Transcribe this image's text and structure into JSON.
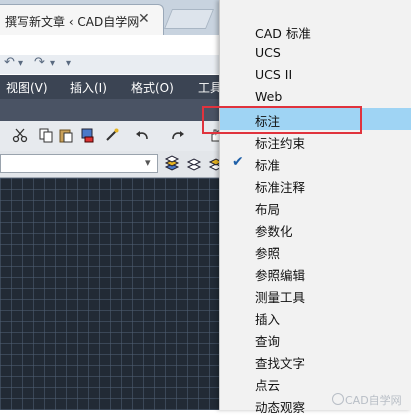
{
  "browser": {
    "tab_title": "撰写新文章 ‹ CAD自学网",
    "tab_close": "✕"
  },
  "quick_access": {
    "undo": "↶",
    "redo": "↷",
    "more": "▾"
  },
  "menubar": {
    "items": [
      "视图(V)",
      "插入(I)",
      "格式(O)",
      "工具"
    ]
  },
  "toolbar": {
    "icons": [
      "cut-icon",
      "copy-icon",
      "paste-icon",
      "match-properties-icon",
      "brush-icon",
      "undo-icon",
      "redo-icon"
    ]
  },
  "context_menu": {
    "items": [
      {
        "label": "CAD 标准",
        "checked": false,
        "highlighted": false
      },
      {
        "label": "UCS",
        "checked": false,
        "highlighted": false
      },
      {
        "label": "UCS II",
        "checked": false,
        "highlighted": false
      },
      {
        "label": "Web",
        "checked": false,
        "highlighted": false
      },
      {
        "label": "标注",
        "checked": false,
        "highlighted": true
      },
      {
        "label": "标注约束",
        "checked": false,
        "highlighted": false
      },
      {
        "label": "标准",
        "checked": true,
        "highlighted": false
      },
      {
        "label": "标准注释",
        "checked": false,
        "highlighted": false
      },
      {
        "label": "布局",
        "checked": false,
        "highlighted": false
      },
      {
        "label": "参数化",
        "checked": false,
        "highlighted": false
      },
      {
        "label": "参照",
        "checked": false,
        "highlighted": false
      },
      {
        "label": "参照编辑",
        "checked": false,
        "highlighted": false
      },
      {
        "label": "测量工具",
        "checked": false,
        "highlighted": false
      },
      {
        "label": "插入",
        "checked": false,
        "highlighted": false
      },
      {
        "label": "查询",
        "checked": false,
        "highlighted": false
      },
      {
        "label": "查找文字",
        "checked": false,
        "highlighted": false
      },
      {
        "label": "点云",
        "checked": false,
        "highlighted": false
      },
      {
        "label": "动态观察",
        "checked": false,
        "highlighted": false
      }
    ],
    "check_glyph": "✔"
  },
  "watermark": "CAD自学网",
  "colors": {
    "menubar": "#3b4453",
    "canvas": "#222a35",
    "highlight": "#9fd4f4",
    "annotation_box": "#e0333d",
    "check": "#1e5fa8"
  }
}
